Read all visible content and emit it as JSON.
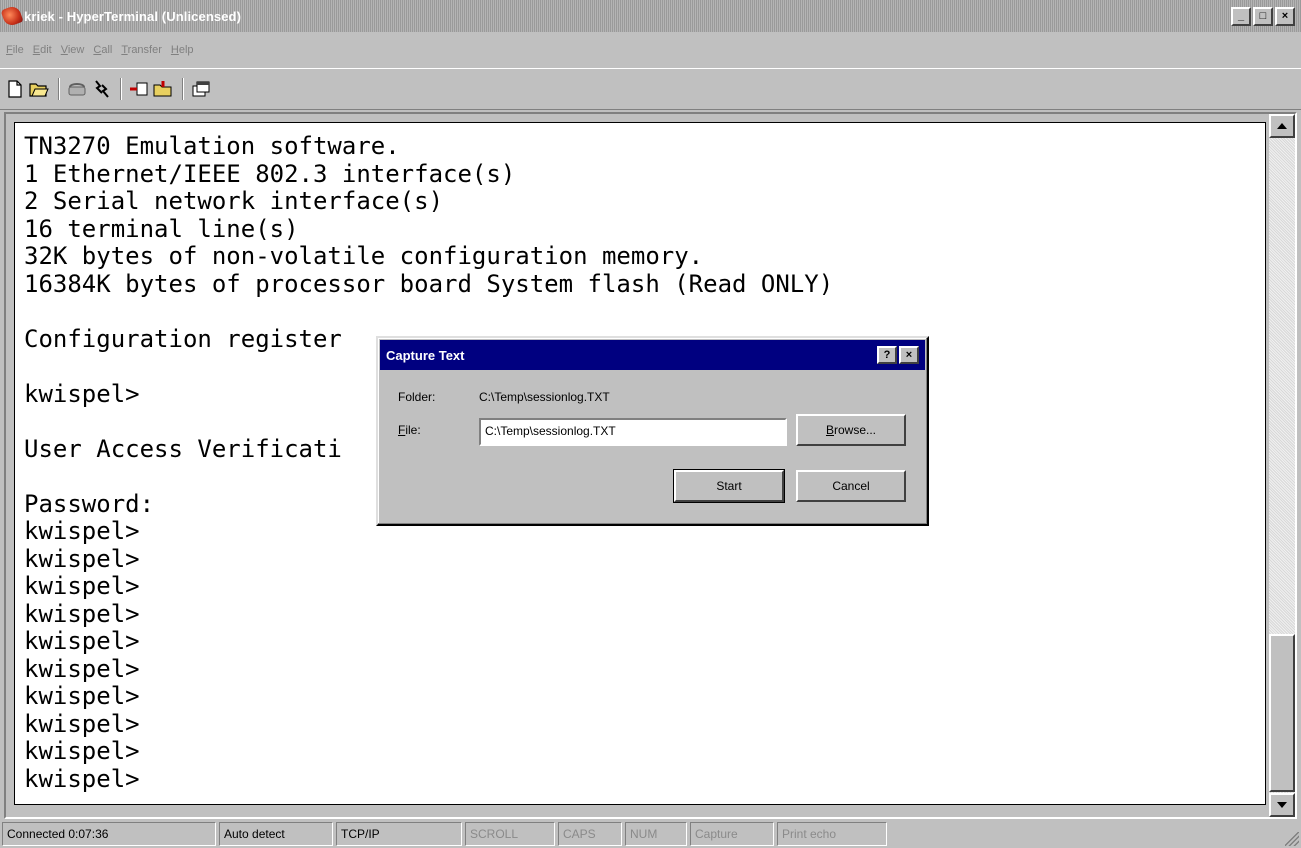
{
  "window": {
    "title": "kriek - HyperTerminal (Unlicensed)",
    "caption_buttons": {
      "minimize": "_",
      "maximize": "□",
      "close": "×"
    }
  },
  "menu": [
    {
      "label": "File",
      "access_key": "F",
      "rest": "ile"
    },
    {
      "label": "Edit",
      "access_key": "E",
      "rest": "dit"
    },
    {
      "label": "View",
      "access_key": "V",
      "rest": "iew"
    },
    {
      "label": "Call",
      "access_key": "C",
      "rest": "all"
    },
    {
      "label": "Transfer",
      "access_key": "T",
      "rest": "ransfer"
    },
    {
      "label": "Help",
      "access_key": "H",
      "rest": "elp"
    }
  ],
  "toolbar": {
    "buttons": [
      "new-icon",
      "open-icon",
      "call-icon",
      "disconnect-icon",
      "send-icon",
      "receive-icon",
      "properties-icon"
    ]
  },
  "terminal": {
    "lines": [
      "TN3270 Emulation software.",
      "1 Ethernet/IEEE 802.3 interface(s)",
      "2 Serial network interface(s)",
      "16 terminal line(s)",
      "32K bytes of non-volatile configuration memory.",
      "16384K bytes of processor board System flash (Read ONLY)",
      "",
      "Configuration register",
      "",
      "kwispel>",
      "",
      "User Access Verificati",
      "",
      "Password:",
      "kwispel>",
      "kwispel>",
      "kwispel>",
      "kwispel>",
      "kwispel>",
      "kwispel>",
      "kwispel>",
      "kwispel>",
      "kwispel>",
      "kwispel>"
    ]
  },
  "dialog": {
    "title": "Capture Text",
    "help_button": "?",
    "close_button": "×",
    "folder_label": "Folder:",
    "folder_value": "C:\\Temp\\sessionlog.TXT",
    "file_label_key": "F",
    "file_label_rest": "ile:",
    "file_value": "C:\\Temp\\sessionlog.TXT",
    "browse_key": "B",
    "browse_rest": "rowse...",
    "start_label": "Start",
    "cancel_label": "Cancel"
  },
  "statusbar": {
    "connected": "Connected 0:07:36",
    "detect": "Auto detect",
    "protocol": "TCP/IP",
    "scroll": "SCROLL",
    "caps": "CAPS",
    "num": "NUM",
    "capture": "Capture",
    "print_echo": "Print echo"
  },
  "colors": {
    "dialog_titlebar": "#000080",
    "window_face": "#c0c0c0",
    "terminal_bg": "#ffffff"
  }
}
